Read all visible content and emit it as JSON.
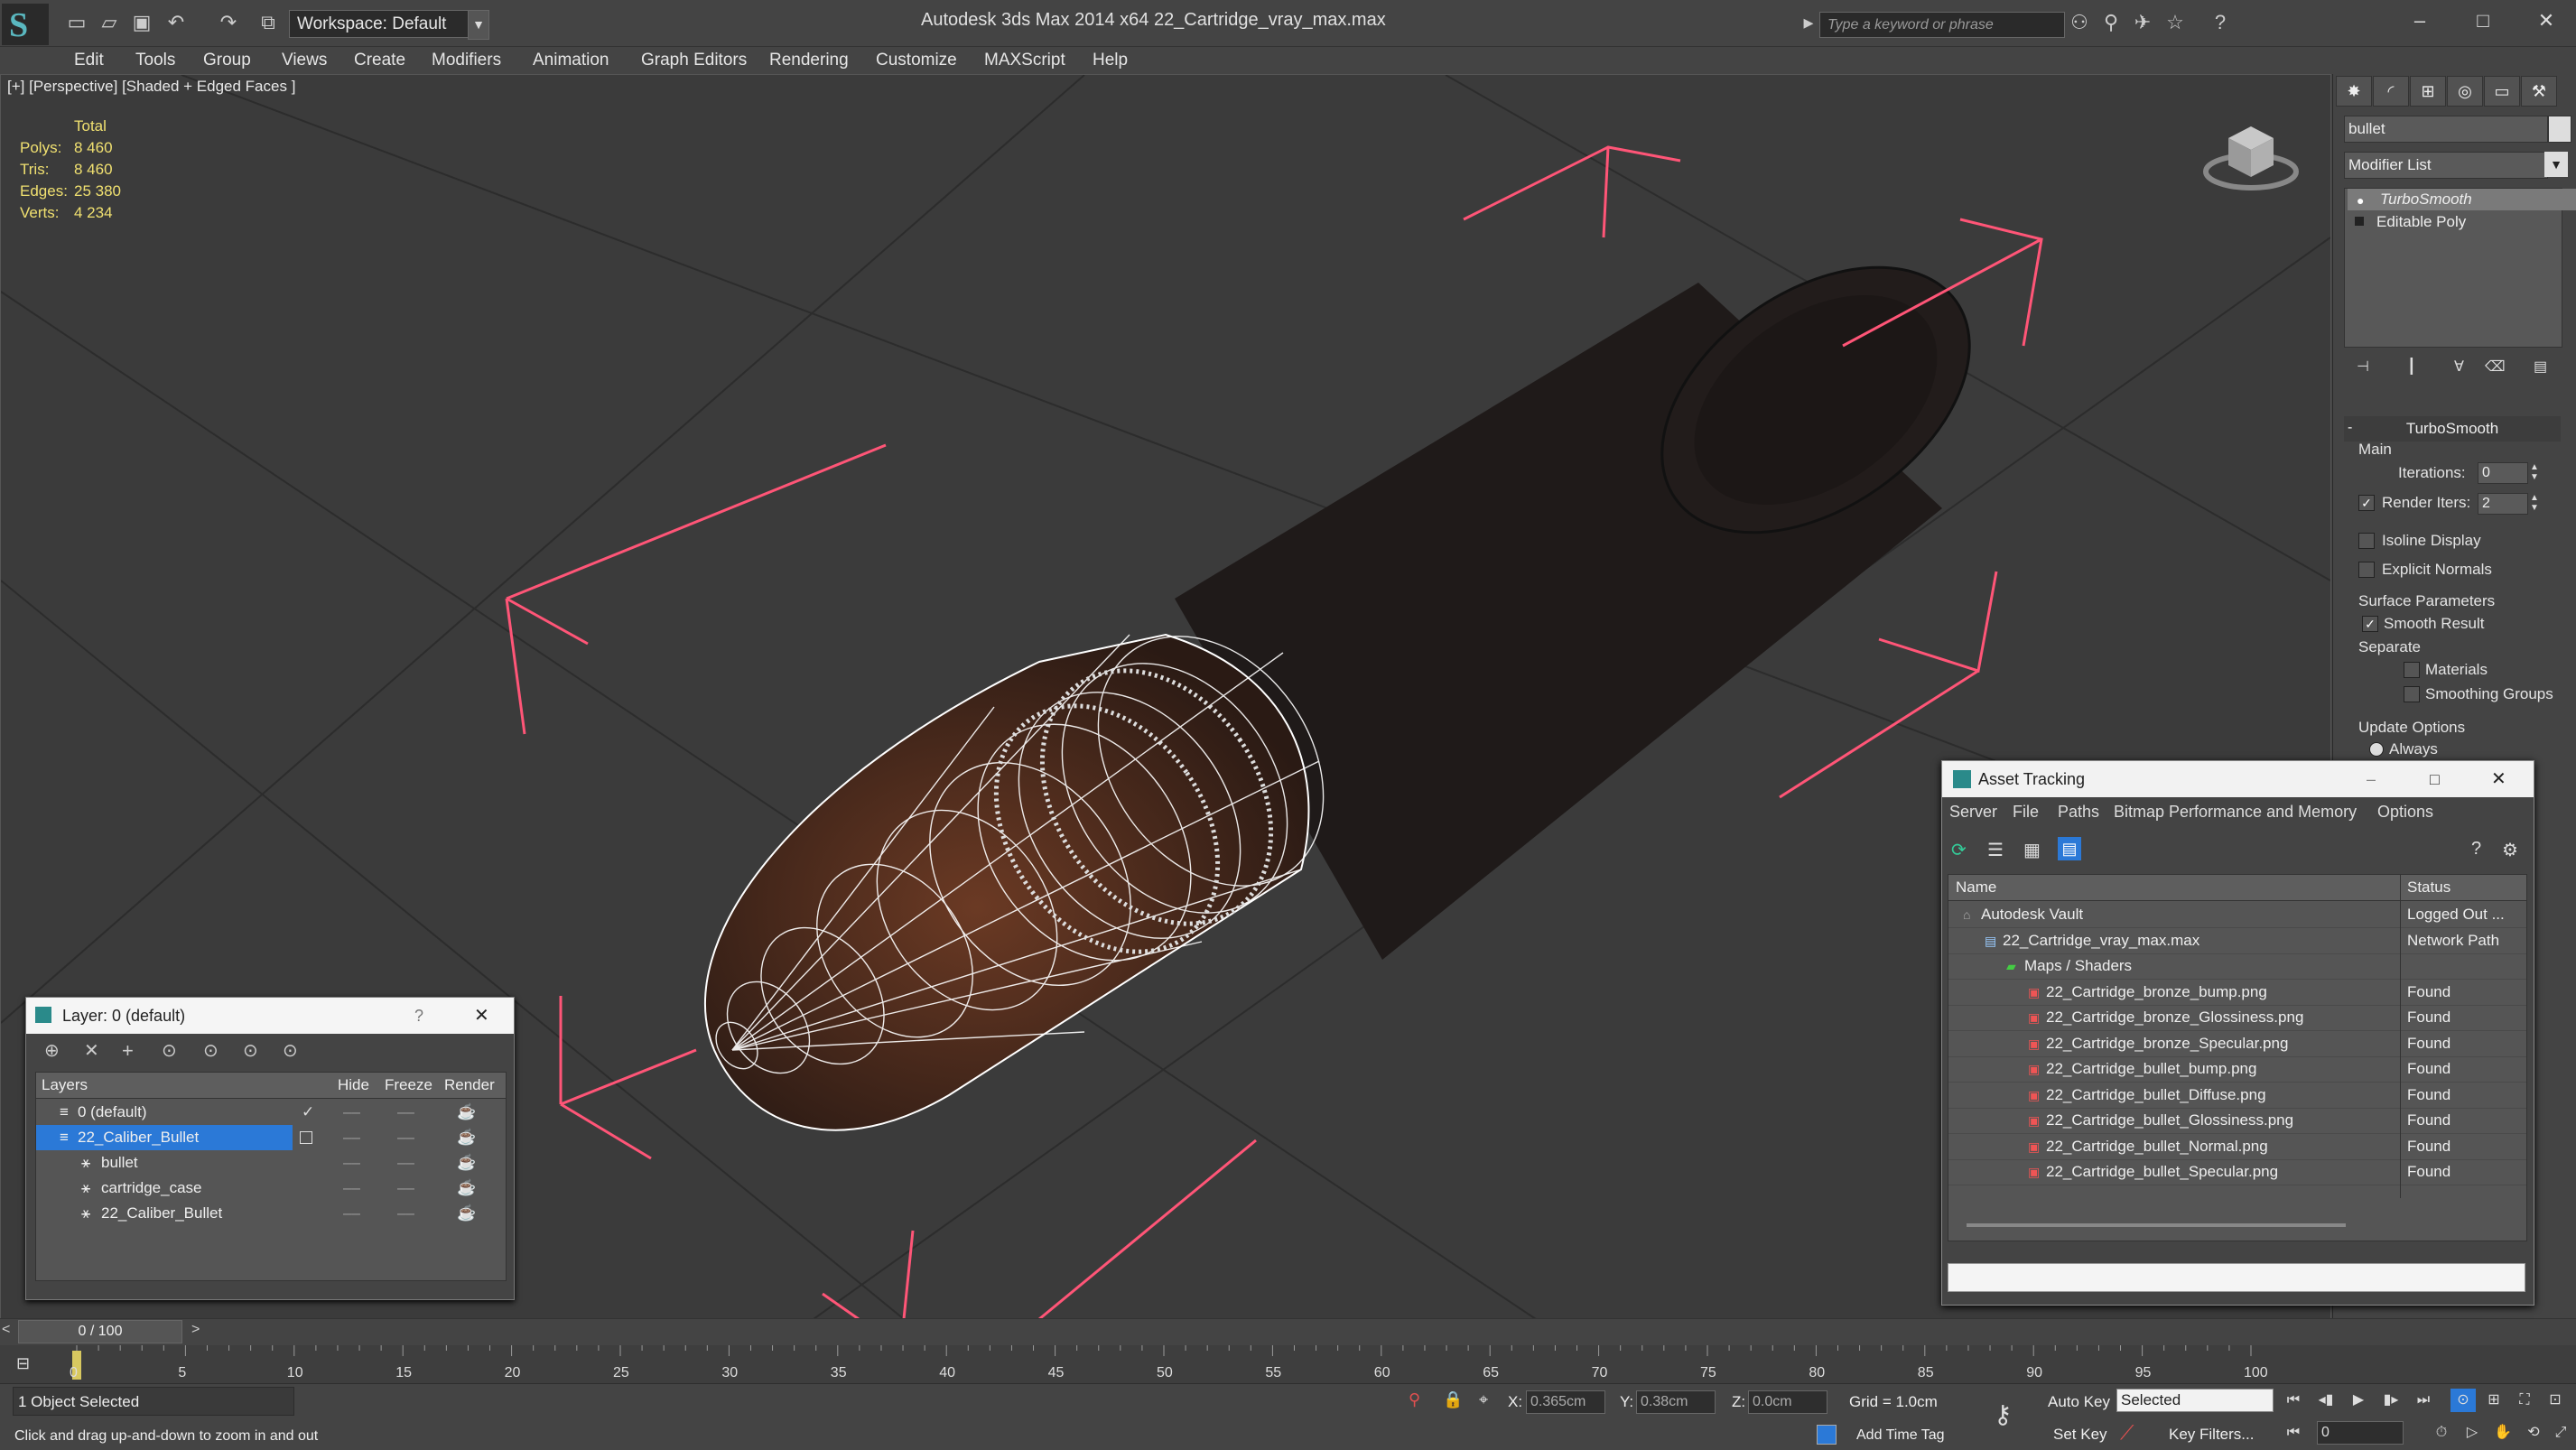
{
  "titlebar": {
    "workspace": "Workspace: Default",
    "title": "Autodesk 3ds Max  2014 x64     22_Cartridge_vray_max.max",
    "search_placeholder": "Type a keyword or phrase"
  },
  "menu": [
    "Edit",
    "Tools",
    "Group",
    "Views",
    "Create",
    "Modifiers",
    "Animation",
    "Graph Editors",
    "Rendering",
    "Customize",
    "MAXScript",
    "Help"
  ],
  "viewport": {
    "label": "[+] [Perspective] [Shaded + Edged Faces ]",
    "stats": {
      "total_label": "Total",
      "polys_label": "Polys:",
      "polys": "8 460",
      "tris_label": "Tris:",
      "tris": "8 460",
      "edges_label": "Edges:",
      "edges": "25 380",
      "verts_label": "Verts:",
      "verts": "4 234"
    }
  },
  "command_panel": {
    "object_name": "bullet",
    "modifier_list": "Modifier List",
    "stack": [
      "TurboSmooth",
      "Editable Poly"
    ],
    "turbosmooth": {
      "title": "TurboSmooth",
      "main": "Main",
      "iterations_label": "Iterations:",
      "iterations": "0",
      "render_iters_label": "Render Iters:",
      "render_iters": "2",
      "isoline": "Isoline Display",
      "explicit_normals": "Explicit Normals",
      "surface_params": "Surface Parameters",
      "smooth_result": "Smooth Result",
      "separate": "Separate",
      "materials": "Materials",
      "smoothing_groups": "Smoothing Groups",
      "update_options": "Update Options",
      "always": "Always"
    }
  },
  "layer_dialog": {
    "title": "Layer: 0 (default)",
    "help": "?",
    "columns": {
      "layers": "Layers",
      "hide": "Hide",
      "freeze": "Freeze",
      "render": "Render"
    },
    "rows": [
      {
        "name": "0 (default)",
        "indent": 0
      },
      {
        "name": "22_Caliber_Bullet",
        "indent": 0
      },
      {
        "name": "bullet",
        "indent": 1
      },
      {
        "name": "cartridge_case",
        "indent": 1
      },
      {
        "name": "22_Caliber_Bullet",
        "indent": 1
      }
    ]
  },
  "asset_dialog": {
    "title": "Asset Tracking",
    "menu": [
      "Server",
      "File",
      "Paths",
      "Bitmap Performance and Memory",
      "Options"
    ],
    "columns": {
      "name": "Name",
      "status": "Status"
    },
    "rows": [
      {
        "name": "Autodesk Vault",
        "status": "Logged Out ...",
        "level": 0
      },
      {
        "name": "22_Cartridge_vray_max.max",
        "status": "Network Path",
        "level": 1
      },
      {
        "name": "Maps / Shaders",
        "status": "",
        "level": 2
      },
      {
        "name": "22_Cartridge_bronze_bump.png",
        "status": "Found",
        "level": 3
      },
      {
        "name": "22_Cartridge_bronze_Glossiness.png",
        "status": "Found",
        "level": 3
      },
      {
        "name": "22_Cartridge_bronze_Specular.png",
        "status": "Found",
        "level": 3
      },
      {
        "name": "22_Cartridge_bullet_bump.png",
        "status": "Found",
        "level": 3
      },
      {
        "name": "22_Cartridge_bullet_Diffuse.png",
        "status": "Found",
        "level": 3
      },
      {
        "name": "22_Cartridge_bullet_Glossiness.png",
        "status": "Found",
        "level": 3
      },
      {
        "name": "22_Cartridge_bullet_Normal.png",
        "status": "Found",
        "level": 3
      },
      {
        "name": "22_Cartridge_bullet_Specular.png",
        "status": "Found",
        "level": 3
      }
    ]
  },
  "timeline": {
    "frame": "0 / 100",
    "ticks": [
      "0",
      "5",
      "10",
      "15",
      "20",
      "25",
      "30",
      "35",
      "40",
      "45",
      "50",
      "55",
      "60",
      "65",
      "70",
      "75",
      "80",
      "85",
      "90",
      "95",
      "100"
    ]
  },
  "status": {
    "selected": "1 Object Selected",
    "prompt": "Click and drag up-and-down to zoom in and out",
    "x_label": "X:",
    "x": "0.365cm",
    "y_label": "Y:",
    "y": "0.38cm",
    "z_label": "Z:",
    "z": "0.0cm",
    "grid": "Grid = 1.0cm",
    "auto_key": "Auto Key",
    "selected_set": "Selected",
    "set_key": "Set Key",
    "key_filters": "Key Filters...",
    "add_time_tag": "Add Time Tag",
    "frame_field": "0"
  },
  "colors": {
    "accent": "#5ab8c0",
    "selection": "#2b79d7",
    "wire": "#ffffff",
    "bounding": "#ff5577"
  }
}
